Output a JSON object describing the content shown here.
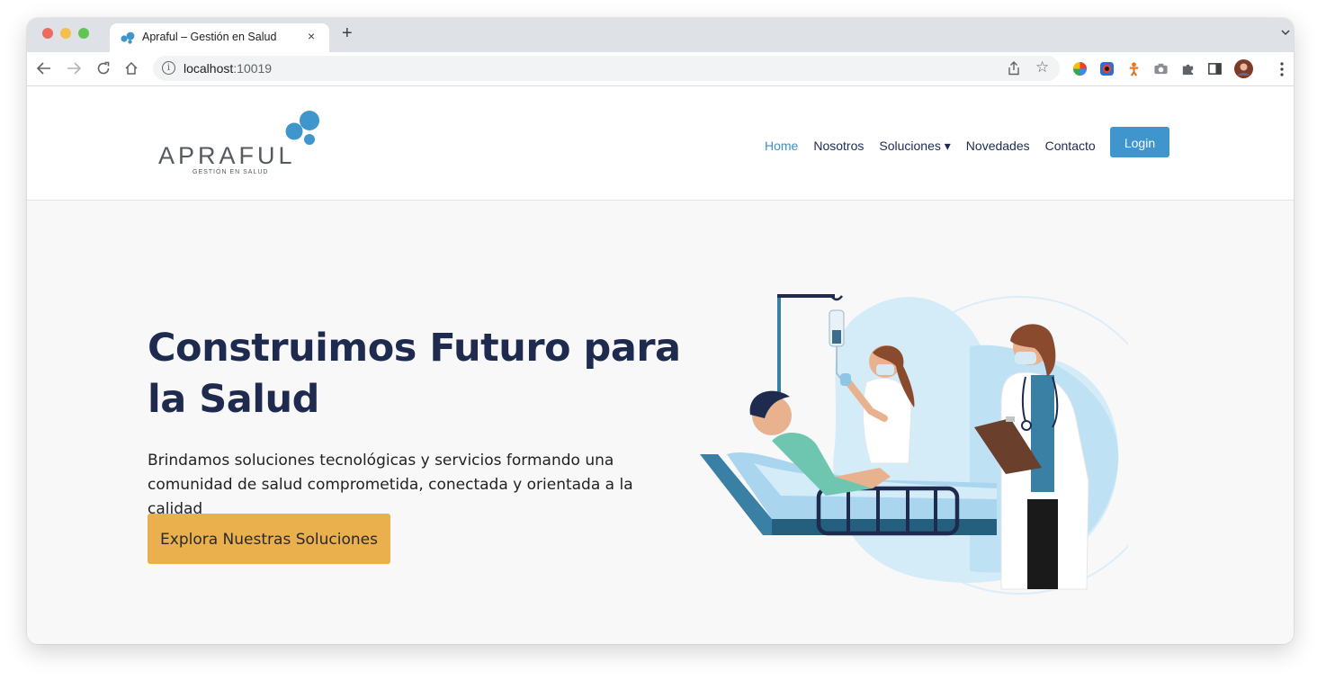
{
  "browser": {
    "tab_title": "Apraful – Gestión en Salud",
    "tab_close": "×",
    "new_tab": "+",
    "url_host": "localhost",
    "url_port": ":10019",
    "icons": [
      "back-icon",
      "forward-icon",
      "reload-icon",
      "home-icon",
      "info-icon",
      "share-icon",
      "bookmark-star-icon",
      "extension-icons",
      "puzzle-icon",
      "sidebar-icon",
      "profile-avatar",
      "kebab-menu-icon"
    ]
  },
  "site": {
    "logo_word": "APRAFUL",
    "logo_sub": "GESTIÓN EN SALUD",
    "nav": [
      {
        "label": "Home",
        "active": true
      },
      {
        "label": "Nosotros"
      },
      {
        "label": "Soluciones ▾"
      },
      {
        "label": "Novedades"
      },
      {
        "label": "Contacto"
      }
    ],
    "login": "Login",
    "colors": {
      "brand_blue": "#3e96cd",
      "navy": "#1e2b4f",
      "cta": "#eab04e"
    }
  },
  "hero": {
    "title": "Construimos Futuro para la Salud",
    "text": "Brindamos soluciones tecnológicas y servicios formando una comunidad de salud comprometida, conectada y orientada a la calidad",
    "cta": "Explora Nuestras Soluciones"
  }
}
